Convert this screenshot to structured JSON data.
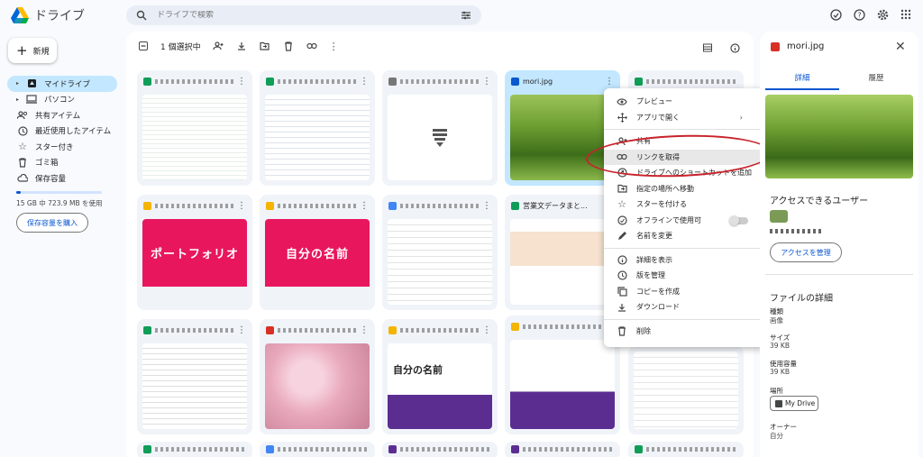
{
  "app": {
    "title": "ドライブ"
  },
  "search": {
    "placeholder": "ドライブで検索"
  },
  "sidebar": {
    "new_label": "新規",
    "items": [
      {
        "label": "マイドライブ",
        "icon": "drive-icon"
      },
      {
        "label": "パソコン",
        "icon": "computer-icon"
      },
      {
        "label": "共有アイテム",
        "icon": "people-icon"
      },
      {
        "label": "最近使用したアイテム",
        "icon": "clock-icon"
      },
      {
        "label": "スター付き",
        "icon": "star-icon"
      },
      {
        "label": "ゴミ箱",
        "icon": "trash-icon"
      },
      {
        "label": "保存容量",
        "icon": "cloud-icon"
      }
    ],
    "storage_text": "15 GB 中 723.9 MB を使用",
    "storage_fraction": 0.048,
    "buy_label": "保存容量を購入"
  },
  "toolbar": {
    "selection": "1 個選択中"
  },
  "files": {
    "selected_name": "mori.jpg",
    "card_text_1": "ポートフォリオ",
    "card_text_2": "自分の名前",
    "card_text_3": "自分の名前",
    "card_name_2_4": "営業文データまと..."
  },
  "menu": {
    "items": [
      {
        "label": "プレビュー",
        "icon": "eye-icon"
      },
      {
        "label": "アプリで開く",
        "icon": "open-with-icon"
      },
      {
        "label": "共有",
        "icon": "person-add-icon"
      },
      {
        "label": "リンクを取得",
        "icon": "link-icon"
      },
      {
        "label": "ドライブへのショートカットを追加",
        "icon": "shortcut-icon"
      },
      {
        "label": "指定の場所へ移動",
        "icon": "move-icon"
      },
      {
        "label": "スターを付ける",
        "icon": "star-icon"
      },
      {
        "label": "オフラインで使用可",
        "icon": "offline-icon"
      },
      {
        "label": "名前を変更",
        "icon": "edit-icon"
      },
      {
        "label": "詳細を表示",
        "icon": "info-icon"
      },
      {
        "label": "版を管理",
        "icon": "history-icon"
      },
      {
        "label": "コピーを作成",
        "icon": "copy-icon"
      },
      {
        "label": "ダウンロード",
        "icon": "download-icon"
      },
      {
        "label": "削除",
        "icon": "trash-icon"
      }
    ]
  },
  "details": {
    "file_name": "mori.jpg",
    "tab_details": "詳細",
    "tab_activity": "履歴",
    "access_heading": "アクセスできるユーザー",
    "manage_label": "アクセスを管理",
    "file_details_heading": "ファイルの詳細",
    "type_label": "種類",
    "type_value": "画像",
    "size_label": "サイズ",
    "size_value": "39 KB",
    "used_label": "使用容量",
    "used_value": "39 KB",
    "location_label": "場所",
    "location_value": "My Drive",
    "owner_label": "オーナー",
    "owner_value": "自分"
  },
  "colors": {
    "accent": "#0b57d0",
    "selected": "#c2e7ff",
    "annotation": "#c8232b",
    "pink": "#e8175d",
    "purple": "#5c2d91"
  }
}
